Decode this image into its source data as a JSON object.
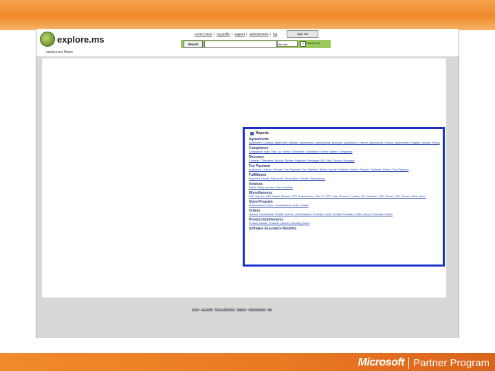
{
  "site": {
    "logo_text": "explore.ms",
    "nav": [
      "current news",
      "my profile",
      "support",
      "administration",
      "log"
    ],
    "signout_label": "sign out",
    "search_button": "Search",
    "search_scope": "this site",
    "search_check_label": "Search Tips",
    "breadcrumb": "explore.ms Home"
  },
  "reports": {
    "title": "Reports",
    "sections": [
      {
        "heading": "Agreements",
        "links": "Agreement Contacts  Agreement Affiliates  Agreements  Amendments  Business Agreements  Partner Agreements  Product Agreements  Program  Special Pricing"
      },
      {
        "heading": "Compliance",
        "links": "Compliance Data Drop Up  Select Enrollment Compliance  Select Master Compliance"
      },
      {
        "heading": "Directory",
        "links": "Contacts  Customers  Product Review Requests  Messages  MS Sites  Service Requests"
      },
      {
        "heading": "Fee Payment",
        "links": "Authorized License Provider Fee Payment  Fee Payment Status Update  Software Advisor Payouts  Software Advisor Fee Payment"
      },
      {
        "heading": "Fulfillment",
        "links": "Shipment Details  Shipments  Subscription Details  Subscriptions"
      },
      {
        "heading": "Invoices",
        "links": "Failed Billing  Invoice Lines  Invoices"
      },
      {
        "heading": "Miscellaneous",
        "links": "LRS Reports  LAR Based Reports  PRS Authorization Stat LS  PRS Lists  Revenue Tracker  SP Activation  CSU Status  CSU Partner Wells  Users"
      },
      {
        "heading": "Open Program",
        "links": "Authorizations  Order Confirmations  Order Details"
      },
      {
        "heading": "Orders",
        "links": "License Confirmation Details  License Confirmations  Purchase Order Details  Purchase Order Issues  Purchase Orders"
      },
      {
        "heading": "Product Entitlements",
        "links": "Product Details  Products  Volume Licensing Rules"
      },
      {
        "heading": "Software Assurance Benefits",
        "links": ""
      }
    ]
  },
  "footer": {
    "links": [
      "home",
      "my profile",
      "terms statement",
      "support",
      "administration",
      "log"
    ]
  },
  "brand": {
    "company": "Microsoft",
    "program": "Partner Program"
  },
  "colors": {
    "accent_orange": "#f08a2a",
    "highlight_border": "#1530cc",
    "search_bar_green": "#9acb5a"
  }
}
